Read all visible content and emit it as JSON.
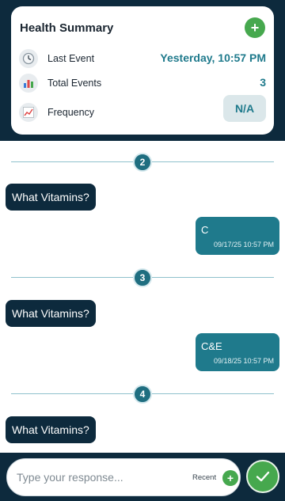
{
  "summary": {
    "title": "Health Summary",
    "add_label": "+",
    "rows": [
      {
        "icon": "clock-icon",
        "label": "Last Event",
        "value": "Yesterday, 10:57 PM"
      },
      {
        "icon": "bar-chart-icon",
        "label": "Total Events",
        "value": "3"
      },
      {
        "icon": "line-chart-icon",
        "label": "Frequency",
        "value": "N/A"
      }
    ]
  },
  "conversation": [
    {
      "number": "2",
      "question": "What Vitamins?",
      "answer": "C",
      "timestamp": "09/17/25 10:57 PM"
    },
    {
      "number": "3",
      "question": "What Vitamins?",
      "answer": "C&E",
      "timestamp": "09/18/25 10:57 PM"
    },
    {
      "number": "4",
      "question": "What Vitamins?"
    }
  ],
  "composer": {
    "placeholder": "Type your response...",
    "recent_label": "Recent",
    "add_label": "+"
  },
  "colors": {
    "navy": "#0d2a3d",
    "teal": "#1f7a8c",
    "green": "#46a84e"
  }
}
